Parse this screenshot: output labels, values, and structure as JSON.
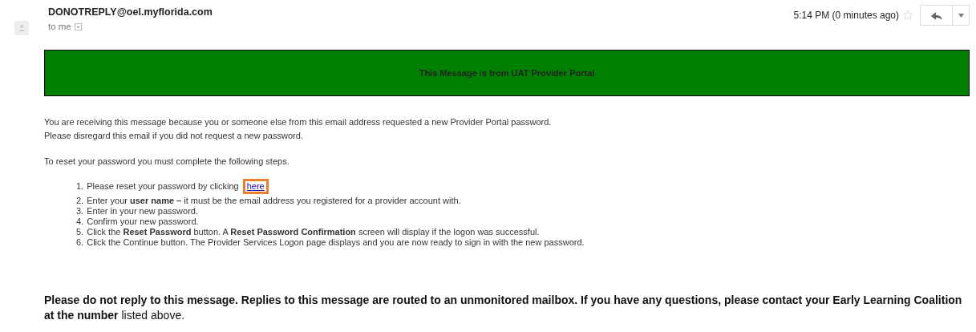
{
  "header": {
    "sender": "DONOTREPLY@oel.myflorida.com",
    "recipient": "to me",
    "time": "5:14 PM (0 minutes ago)",
    "starred": false
  },
  "banner": {
    "text": "This Message is from UAT Provider Portal",
    "color": "#008000"
  },
  "intro": [
    "You are receiving this message because you or someone else from this email address requested a new Provider Portal password.",
    "Please disregard this email if you did not request a new password."
  ],
  "steps_heading": "To reset your password you must complete the following steps.",
  "steps": [
    {
      "number": "1.",
      "text": "Please reset your password by clicking",
      "link": "here",
      "highlighted": true
    },
    {
      "number": "2.",
      "text": "Enter your **user name –** it must be the email address you registered for a provider account with."
    },
    {
      "number": "3.",
      "text": "Enter in your new password."
    },
    {
      "number": "4.",
      "text": "Confirm your new password."
    },
    {
      "number": "5.",
      "text": "Click the **Reset Password** button. A **Reset Password Confirmation** screen will display if the logon was successful."
    },
    {
      "number": "6.",
      "text": "Click the Continue button. The Provider Services Logon page displays and you are now ready to sign in with the new password."
    }
  ],
  "footer": "**Please do not reply to this message. Replies to this message are routed to an unmonitored mailbox. If you have any questions, please contact your Early Learning Coalition at the number** listed above."
}
